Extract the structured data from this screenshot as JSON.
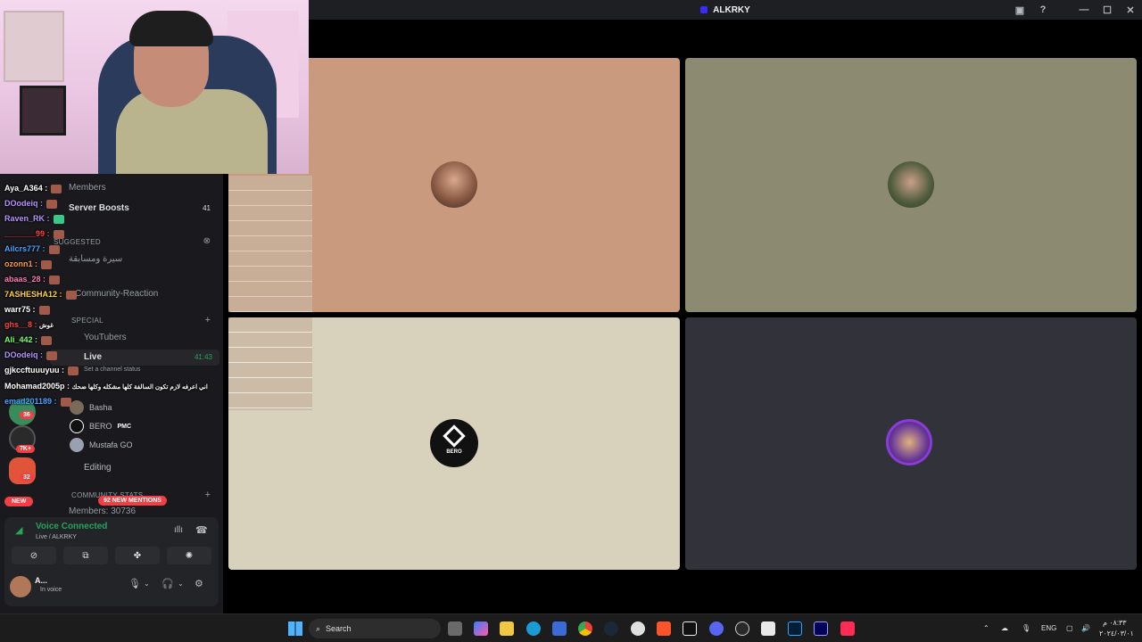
{
  "window": {
    "title": "ALKRKY"
  },
  "sidebar": {
    "rows": [
      {
        "label": "Members",
        "type": "channel"
      },
      {
        "label": "Server Boosts",
        "count": "41",
        "type": "channel"
      },
      {
        "label": "Suggested",
        "type": "category"
      },
      {
        "label": "سيرة ومسابقة",
        "type": "channel"
      },
      {
        "label": "Community-Reaction",
        "type": "channel"
      },
      {
        "label": "SPECIAL",
        "type": "category"
      },
      {
        "label": "YouTubers",
        "type": "channel"
      },
      {
        "label": "Live",
        "time": "41:43",
        "type": "channel"
      },
      {
        "label": "Set a channel status",
        "type": "status"
      },
      {
        "label": "Editing",
        "type": "channel"
      },
      {
        "label": "COMMUNITY STATS",
        "type": "category"
      },
      {
        "label": "Members: 30736",
        "type": "channel"
      }
    ],
    "members": [
      {
        "name": "Basha"
      },
      {
        "name": "BERO",
        "tag": "PMC"
      },
      {
        "name": "Mustafa GO"
      }
    ],
    "guild_badges": [
      "36",
      "7K+",
      "32"
    ],
    "new_label": "NEW",
    "mentions_label": "92 NEW MENTIONS"
  },
  "chat": [
    {
      "user": "Aya_A364 :",
      "color": "#ffffff"
    },
    {
      "user": "DOodeiq :",
      "color": "#b794ff"
    },
    {
      "user": "Raven_RK :",
      "color": "#b794ff"
    },
    {
      "user": "_______99 :",
      "color": "#ff4040"
    },
    {
      "user": "Ailcrs777 :",
      "color": "#4aa3ff"
    },
    {
      "user": "ozonn1 :",
      "color": "#ff9a3c"
    },
    {
      "user": "abaas_28 :",
      "color": "#ff7ab8"
    },
    {
      "user": "7ASHESHA12 :",
      "color": "#ffd23c"
    },
    {
      "user": "warr75 :",
      "color": "#ffffff"
    },
    {
      "user": "ghs__8 :",
      "color": "#ff4040",
      "msg": "غوش"
    },
    {
      "user": "Ali_442 :",
      "color": "#7dff6b"
    },
    {
      "user": "DOodeiq :",
      "color": "#b794ff"
    },
    {
      "user": "gjkccftuuuyuu :",
      "color": "#ffffff"
    },
    {
      "user": "Mohamad2005p :",
      "color": "#ffffff",
      "msg": "اني اعرفه لازم تكون السالفة كلها مشكله وكلها ضحك"
    },
    {
      "user": "emad201189 :",
      "color": "#4aa3ff"
    }
  ],
  "voice": {
    "status": "Voice Connected",
    "channel": "Live / ALKRKY",
    "user_name": "A...",
    "user_status": "In voice"
  },
  "tiles": [
    {
      "bg": "#c99a7d"
    },
    {
      "bg": "#8d8a72"
    },
    {
      "bg": "#d8d2bc",
      "logo_text": "BERO"
    },
    {
      "bg": "#32323b"
    }
  ],
  "taskbar": {
    "search_placeholder": "Search",
    "lang": "ENG",
    "time": "٠٨:٣٣ م",
    "date": "٢٠٢٤/٠٣/٠١"
  }
}
